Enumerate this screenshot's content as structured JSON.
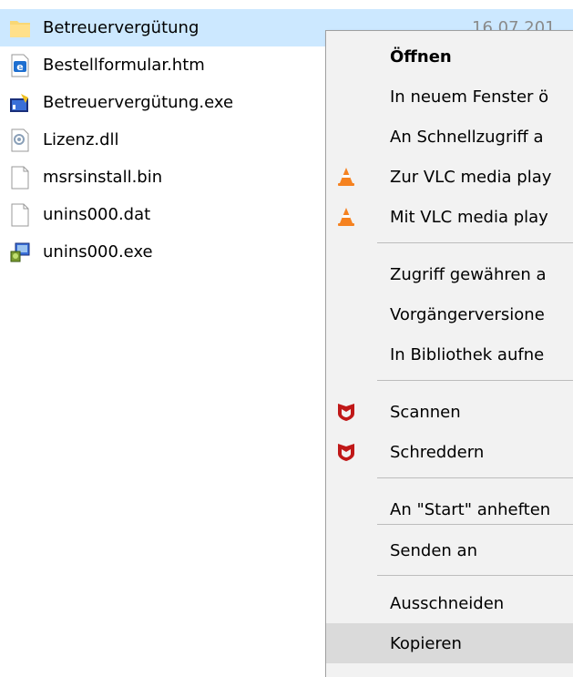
{
  "files": [
    {
      "name": "Betreuervergütung",
      "icon": "folder-icon",
      "selected": true,
      "date": "16.07.201"
    },
    {
      "name": "Bestellformular.htm",
      "icon": "html-file-icon"
    },
    {
      "name": "Betreuervergütung.exe",
      "icon": "exe-app-icon"
    },
    {
      "name": "Lizenz.dll",
      "icon": "dll-file-icon"
    },
    {
      "name": "msrsinstall.bin",
      "icon": "blank-file-icon"
    },
    {
      "name": "unins000.dat",
      "icon": "blank-file-icon"
    },
    {
      "name": "unins000.exe",
      "icon": "installer-icon"
    }
  ],
  "context_menu": {
    "items": [
      {
        "label": "Öffnen",
        "bold": true
      },
      {
        "label": "In neuem Fenster ö"
      },
      {
        "label": "An Schnellzugriff a"
      },
      {
        "label": "Zur VLC media play",
        "icon": "vlc-cone-icon"
      },
      {
        "label": "Mit VLC media play",
        "icon": "vlc-cone-icon"
      },
      {
        "label": "Zugriff gewähren a"
      },
      {
        "label": "Vorgängerversione"
      },
      {
        "label": "In Bibliothek aufne"
      },
      {
        "label": "Scannen",
        "icon": "mcafee-shield-icon"
      },
      {
        "label": "Schreddern",
        "icon": "mcafee-shield-icon"
      },
      {
        "label": "An \"Start\" anheften"
      },
      {
        "label": "Senden an"
      },
      {
        "label": "Ausschneiden"
      },
      {
        "label": "Kopieren",
        "hovered": true
      }
    ]
  },
  "colors": {
    "selection": "#cce8ff",
    "menu_background": "#f2f2f2",
    "menu_hover": "#dadada",
    "vlc_orange": "#f58220",
    "mcafee_red": "#c01818"
  }
}
